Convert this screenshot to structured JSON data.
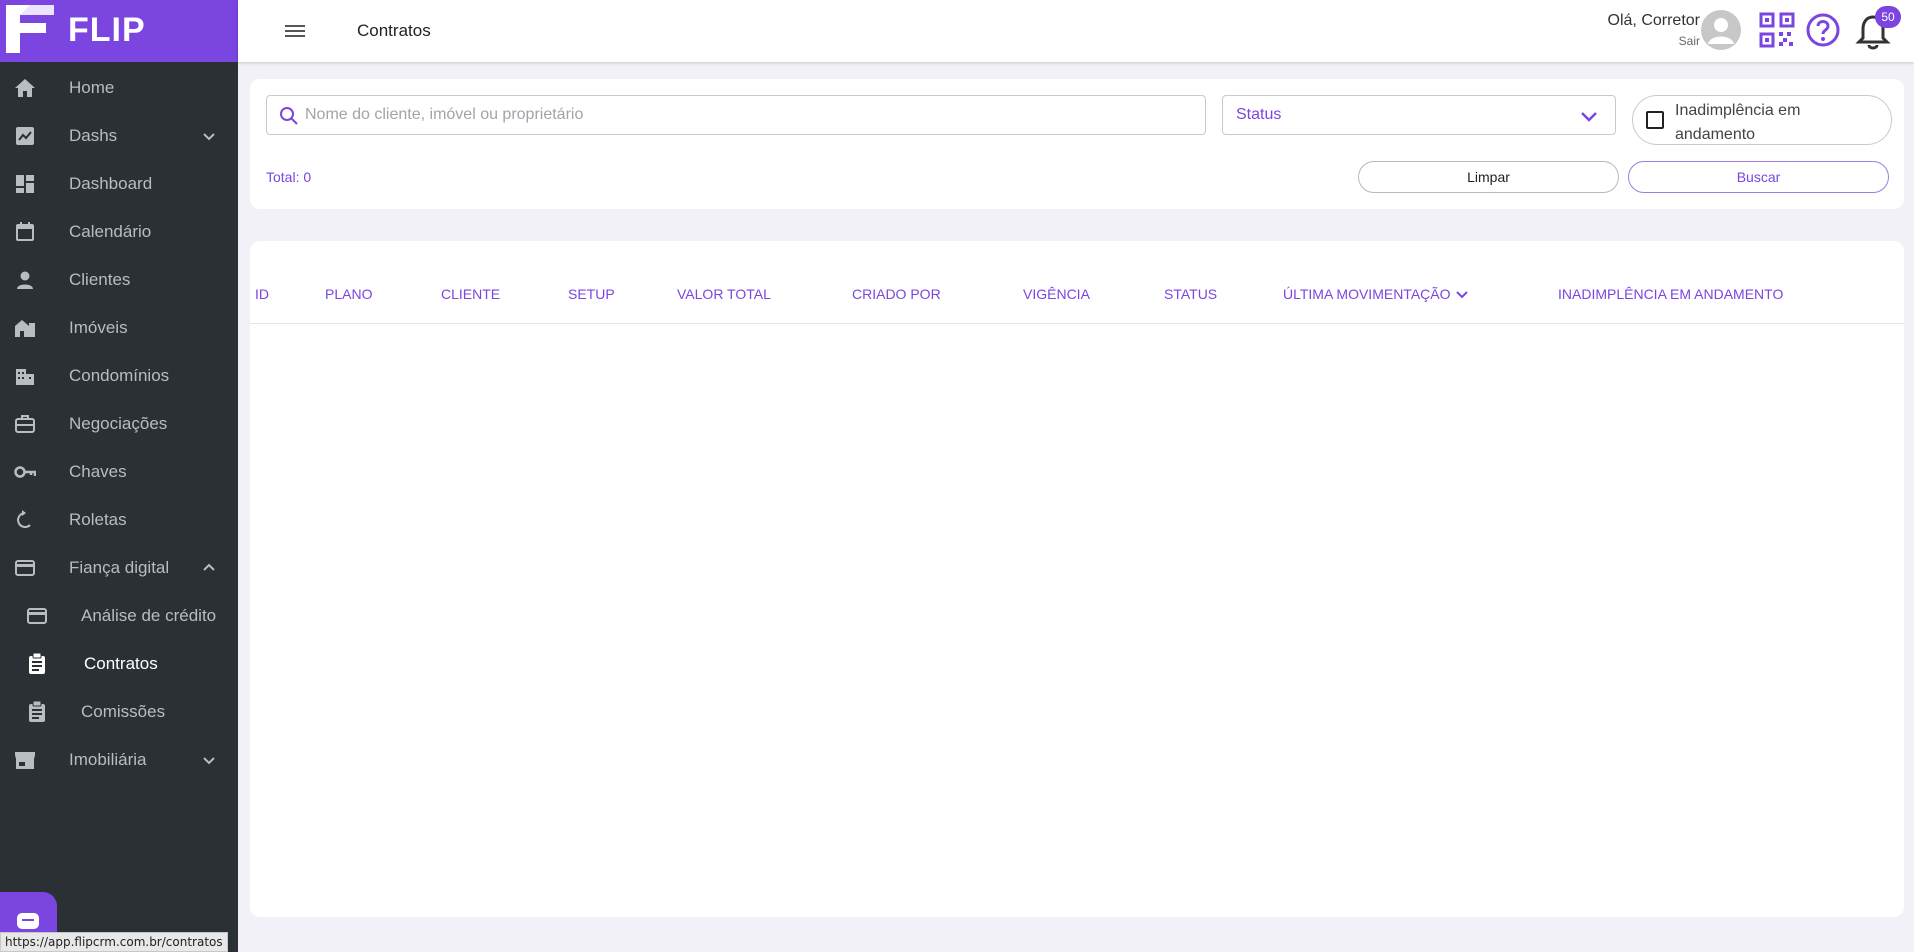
{
  "brand": {
    "name": "FLIP",
    "color": "#7b45e0"
  },
  "sidebar": {
    "items": [
      {
        "label": "Home",
        "icon": "home-icon"
      },
      {
        "label": "Dashs",
        "icon": "trend-chart-icon",
        "expandable": true,
        "expanded": false
      },
      {
        "label": "Dashboard",
        "icon": "dashboard-icon"
      },
      {
        "label": "Calendário",
        "icon": "calendar-icon"
      },
      {
        "label": "Clientes",
        "icon": "person-icon"
      },
      {
        "label": "Imóveis",
        "icon": "house-icon"
      },
      {
        "label": "Condomínios",
        "icon": "building-icon"
      },
      {
        "label": "Negociações",
        "icon": "briefcase-icon"
      },
      {
        "label": "Chaves",
        "icon": "key-icon"
      },
      {
        "label": "Roletas",
        "icon": "rotate-icon"
      },
      {
        "label": "Fiança digital",
        "icon": "credit-card-icon",
        "expandable": true,
        "expanded": true
      },
      {
        "label": "Análise de crédito",
        "icon": "credit-card-icon",
        "sub": true
      },
      {
        "label": "Contratos",
        "icon": "clipboard-icon",
        "sub": true,
        "active": true
      },
      {
        "label": "Comissões",
        "icon": "clipboard-icon",
        "sub": true
      },
      {
        "label": "Imobiliária",
        "icon": "store-icon",
        "expandable": true,
        "expanded": false
      }
    ]
  },
  "header": {
    "title": "Contratos",
    "greeting": "Olá, Corretor",
    "logout": "Sair",
    "notifications_count": "50"
  },
  "filters": {
    "search_placeholder": "Nome do cliente, imóvel ou proprietário",
    "search_value": "",
    "status_label": "Status",
    "overdue_label": "Inadimplência em andamento",
    "overdue_checked": false,
    "total": "Total: 0",
    "clear_label": "Limpar",
    "search_label": "Buscar"
  },
  "table": {
    "columns": [
      "ID",
      "PLANO",
      "CLIENTE",
      "SETUP",
      "VALOR TOTAL",
      "CRIADO POR",
      "VIGÊNCIA",
      "STATUS",
      "ÚLTIMA MOVIMENTAÇÃO",
      "INADIMPLÊNCIA EM ANDAMENTO"
    ],
    "sorted_column": "ÚLTIMA MOVIMENTAÇÃO",
    "sort_direction": "desc",
    "rows": []
  },
  "statusbar": {
    "url": "https://app.flipcrm.com.br/contratos"
  }
}
